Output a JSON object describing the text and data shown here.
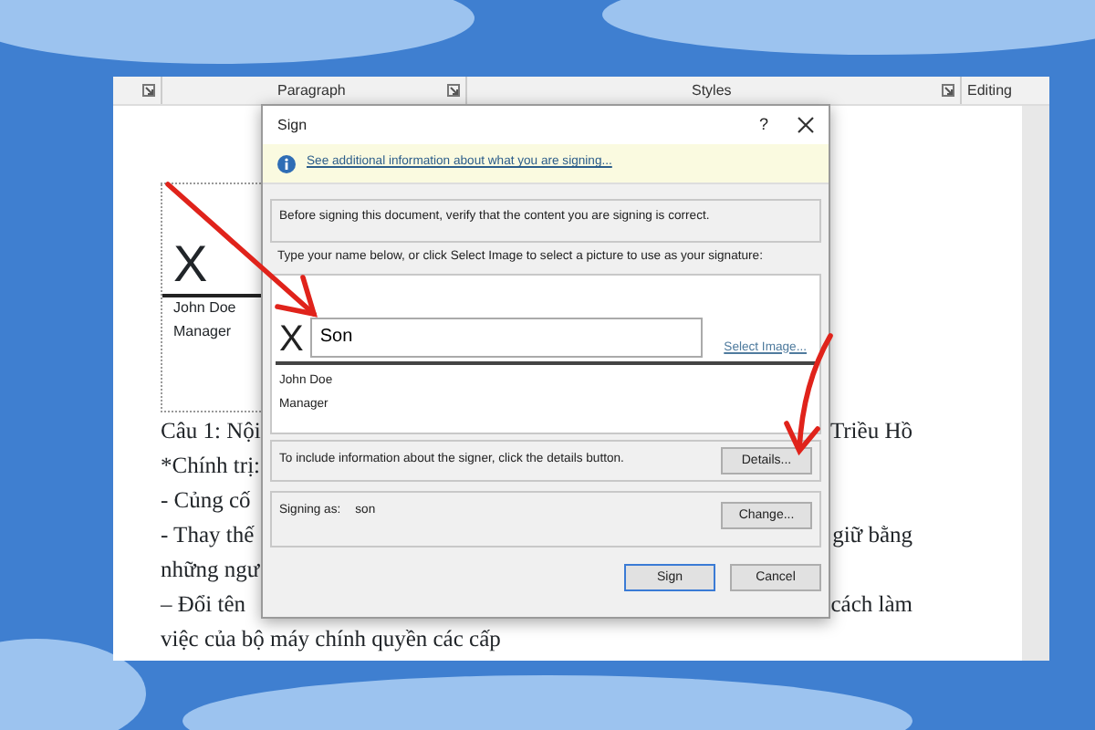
{
  "ribbon": {
    "groups": [
      {
        "launcher": true
      },
      {
        "label": "Paragraph",
        "launcher": true
      },
      {
        "label": "Styles",
        "launcher": true
      },
      {
        "label": "Editing",
        "launcher": false
      }
    ]
  },
  "document": {
    "signature_line": {
      "mark": "X",
      "name": "John Doe",
      "title": "Manager"
    },
    "lines": [
      {
        "left": "Câu 1: Nội",
        "right": "Triều Hồ"
      },
      {
        "left": "*Chính trị:"
      },
      {
        "left": "- Củng cố"
      },
      {
        "left": "- Thay thế",
        "right": "giữ bằng"
      },
      {
        "left": "những ngư"
      },
      {
        "left": "– Đổi tên",
        "right": "cách làm"
      },
      {
        "left": "việc của bộ máy chính quyền các cấp"
      }
    ]
  },
  "dialog": {
    "title": "Sign",
    "help": "?",
    "info_link": "See additional information about what you are signing...",
    "verify_text": "Before signing this document, verify that the content you are signing is correct.",
    "instructions": "Type your name below, or click Select Image to select a picture to use as your signature:",
    "signature": {
      "mark": "X",
      "value": "Son",
      "select_image": "Select Image...",
      "signer_name": "John Doe",
      "signer_title": "Manager"
    },
    "details_text": "To include information about the signer, click the details button.",
    "details_button": "Details...",
    "signing_as_label": "Signing as:",
    "signing_as_value": "son",
    "change_button": "Change...",
    "buttons": [
      {
        "label": "Sign",
        "default": true
      },
      {
        "label": "Cancel",
        "default": false
      }
    ]
  },
  "annotations": [
    {
      "kind": "straight"
    },
    {
      "kind": "curved"
    }
  ]
}
